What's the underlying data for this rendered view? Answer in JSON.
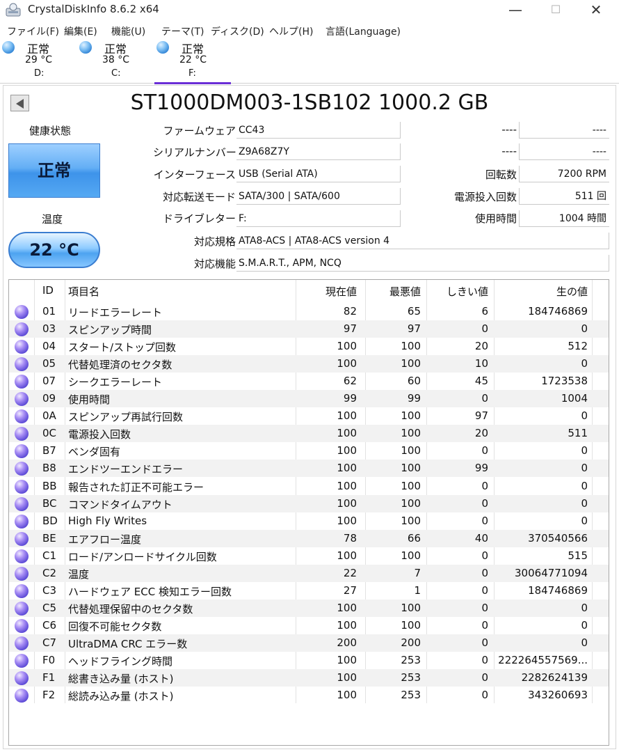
{
  "window": {
    "title": "CrystalDiskInfo 8.6.2 x64",
    "minimize": "—",
    "maximize": "☐",
    "close": "✕"
  },
  "menu": [
    "ファイル(F)",
    "編集(E)",
    "機能(U)",
    "テーマ(T)",
    "ディスク(D)",
    "ヘルプ(H)",
    "言語(Language)"
  ],
  "drives": [
    {
      "status": "正常",
      "temp": "29 °C",
      "letter": "D:"
    },
    {
      "status": "正常",
      "temp": "38 °C",
      "letter": "C:"
    },
    {
      "status": "正常",
      "temp": "22 °C",
      "letter": "F:",
      "selected": true
    }
  ],
  "disk": {
    "title": "ST1000DM003-1SB102 1000.2 GB",
    "health_label": "健康状態",
    "health_status": "正常",
    "temp_label": "温度",
    "temperature": "22 °C",
    "firmware_label": "ファームウェア",
    "firmware": "CC43",
    "serial_label": "シリアルナンバー",
    "serial": "Z9A68Z7Y",
    "interface_label": "インターフェース",
    "interface": "USB (Serial ATA)",
    "transfer_label": "対応転送モード",
    "transfer": "SATA/300 | SATA/600",
    "drive_letter_label": "ドライブレター",
    "drive_letter": "F:",
    "standard_label": "対応規格",
    "standard": "ATA8-ACS | ATA8-ACS version 4",
    "features_label": "対応機能",
    "features": "S.M.A.R.T., APM, NCQ",
    "right1_label": "----",
    "right1_value": "----",
    "right2_label": "----",
    "right2_value": "----",
    "rotation_label": "回転数",
    "rotation": "7200 RPM",
    "power_count_label": "電源投入回数",
    "power_count": "511 回",
    "power_hours_label": "使用時間",
    "power_hours": "1004 時間"
  },
  "smart": {
    "headers": {
      "id": "ID",
      "name": "項目名",
      "current": "現在値",
      "worst": "最悪値",
      "threshold": "しきい値",
      "raw": "生の値"
    },
    "rows": [
      {
        "id": "01",
        "name": "リードエラーレート",
        "current": "82",
        "worst": "65",
        "threshold": "6",
        "raw": "184746869"
      },
      {
        "id": "03",
        "name": "スピンアップ時間",
        "current": "97",
        "worst": "97",
        "threshold": "0",
        "raw": "0"
      },
      {
        "id": "04",
        "name": "スタート/ストップ回数",
        "current": "100",
        "worst": "100",
        "threshold": "20",
        "raw": "512"
      },
      {
        "id": "05",
        "name": "代替処理済のセクタ数",
        "current": "100",
        "worst": "100",
        "threshold": "10",
        "raw": "0"
      },
      {
        "id": "07",
        "name": "シークエラーレート",
        "current": "62",
        "worst": "60",
        "threshold": "45",
        "raw": "1723538"
      },
      {
        "id": "09",
        "name": "使用時間",
        "current": "99",
        "worst": "99",
        "threshold": "0",
        "raw": "1004"
      },
      {
        "id": "0A",
        "name": "スピンアップ再試行回数",
        "current": "100",
        "worst": "100",
        "threshold": "97",
        "raw": "0"
      },
      {
        "id": "0C",
        "name": "電源投入回数",
        "current": "100",
        "worst": "100",
        "threshold": "20",
        "raw": "511"
      },
      {
        "id": "B7",
        "name": "ベンダ固有",
        "current": "100",
        "worst": "100",
        "threshold": "0",
        "raw": "0"
      },
      {
        "id": "B8",
        "name": "エンドツーエンドエラー",
        "current": "100",
        "worst": "100",
        "threshold": "99",
        "raw": "0"
      },
      {
        "id": "BB",
        "name": "報告された訂正不可能エラー",
        "current": "100",
        "worst": "100",
        "threshold": "0",
        "raw": "0"
      },
      {
        "id": "BC",
        "name": "コマンドタイムアウト",
        "current": "100",
        "worst": "100",
        "threshold": "0",
        "raw": "0"
      },
      {
        "id": "BD",
        "name": "High Fly Writes",
        "current": "100",
        "worst": "100",
        "threshold": "0",
        "raw": "0"
      },
      {
        "id": "BE",
        "name": "エアフロー温度",
        "current": "78",
        "worst": "66",
        "threshold": "40",
        "raw": "370540566"
      },
      {
        "id": "C1",
        "name": "ロード/アンロードサイクル回数",
        "current": "100",
        "worst": "100",
        "threshold": "0",
        "raw": "515"
      },
      {
        "id": "C2",
        "name": "温度",
        "current": "22",
        "worst": "7",
        "threshold": "0",
        "raw": "30064771094"
      },
      {
        "id": "C3",
        "name": "ハードウェア ECC 検知エラー回数",
        "current": "27",
        "worst": "1",
        "threshold": "0",
        "raw": "184746869"
      },
      {
        "id": "C5",
        "name": "代替処理保留中のセクタ数",
        "current": "100",
        "worst": "100",
        "threshold": "0",
        "raw": "0"
      },
      {
        "id": "C6",
        "name": "回復不可能セクタ数",
        "current": "100",
        "worst": "100",
        "threshold": "0",
        "raw": "0"
      },
      {
        "id": "C7",
        "name": "UltraDMA CRC エラー数",
        "current": "200",
        "worst": "200",
        "threshold": "0",
        "raw": "0"
      },
      {
        "id": "F0",
        "name": "ヘッドフライング時間",
        "current": "100",
        "worst": "253",
        "threshold": "0",
        "raw": "222264557569..."
      },
      {
        "id": "F1",
        "name": "総書き込み量 (ホスト)",
        "current": "100",
        "worst": "253",
        "threshold": "0",
        "raw": "2282624139"
      },
      {
        "id": "F2",
        "name": "総読み込み量 (ホスト)",
        "current": "100",
        "worst": "253",
        "threshold": "0",
        "raw": "343260693"
      }
    ]
  }
}
